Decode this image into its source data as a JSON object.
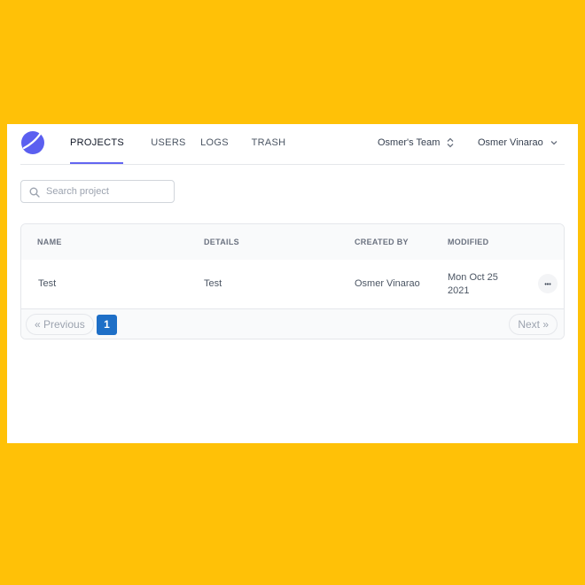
{
  "nav": {
    "tabs": [
      {
        "label": "PROJECTS",
        "active": true
      },
      {
        "label": "USERS",
        "active": false
      },
      {
        "label": "LOGS",
        "active": false
      },
      {
        "label": "TRASH",
        "active": false
      }
    ],
    "team": "Osmer's Team",
    "user": "Osmer Vinarao",
    "logo_icon": "app-logo-icon"
  },
  "search": {
    "placeholder": "Search project",
    "value": ""
  },
  "table": {
    "columns": [
      "NAME",
      "DETAILS",
      "CREATED BY",
      "MODIFIED"
    ],
    "rows": [
      {
        "name": "Test",
        "details": "Test",
        "created_by": "Osmer Vinarao",
        "modified_line1": "Mon Oct 25",
        "modified_line2": "2021",
        "menu": "•••"
      }
    ]
  },
  "pagination": {
    "previous": "« Previous",
    "next": "Next »",
    "current_page": "1"
  },
  "colors": {
    "background": "#FFC107",
    "accent": "#6366f1",
    "page_active": "#1e6fc7"
  }
}
